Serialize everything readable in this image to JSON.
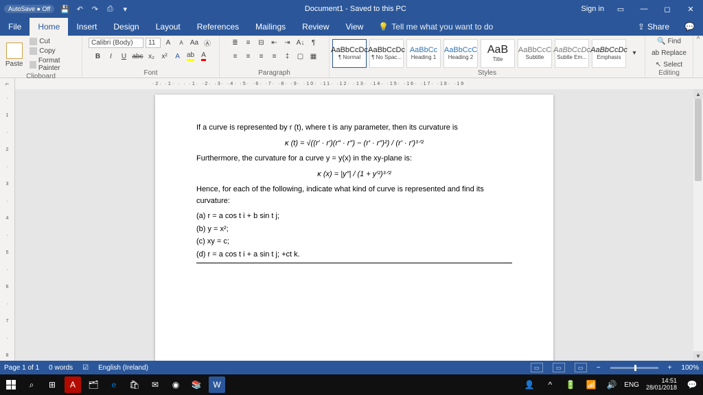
{
  "titlebar": {
    "autosave": "AutoSave ● Off",
    "title": "Document1 - Saved to this PC",
    "signin": "Sign in"
  },
  "tabs": {
    "file": "File",
    "home": "Home",
    "insert": "Insert",
    "design": "Design",
    "layout": "Layout",
    "references": "References",
    "mailings": "Mailings",
    "review": "Review",
    "view": "View",
    "tellme": "Tell me what you want to do",
    "share": "Share"
  },
  "ribbon": {
    "clipboard": {
      "label": "Clipboard",
      "paste": "Paste",
      "cut": "Cut",
      "copy": "Copy",
      "painter": "Format Painter"
    },
    "font": {
      "label": "Font",
      "name": "Calibri (Body)",
      "size": "11",
      "grow": "A",
      "shrink": "A",
      "case": "Aa",
      "bold": "B",
      "italic": "I",
      "underline": "U",
      "strike": "abc",
      "sub": "x₂",
      "sup": "x²",
      "effects": "A"
    },
    "paragraph": {
      "label": "Paragraph"
    },
    "styles": {
      "label": "Styles",
      "items": [
        {
          "sample": "AaBbCcDc",
          "name": "¶ Normal"
        },
        {
          "sample": "AaBbCcDc",
          "name": "¶ No Spac..."
        },
        {
          "sample": "AaBbCc",
          "name": "Heading 1"
        },
        {
          "sample": "AaBbCcC",
          "name": "Heading 2"
        },
        {
          "sample": "AaB",
          "name": "Title"
        },
        {
          "sample": "AaBbCcC",
          "name": "Subtitle"
        },
        {
          "sample": "AaBbCcDc",
          "name": "Subtle Em..."
        },
        {
          "sample": "AaBbCcDc",
          "name": "Emphasis"
        }
      ]
    },
    "editing": {
      "label": "Editing",
      "find": "Find",
      "replace": "Replace",
      "select": "Select"
    }
  },
  "ruler_corner": "⌐",
  "doc": {
    "p1": "If a curve is represented by r (t), where t is any parameter, then its curvature is",
    "eq1": "κ (t) = √((r′ · r′)(r″ · r″) − (r′ · r″)²) / (r′ · r′)³ᐟ²",
    "p2": "Furthermore, the curvature for a curve y = y(x) in the xy-plane is:",
    "eq2": "κ (x) = |y″| / (1 + y′²)³ᐟ²",
    "p3": "Hence, for each of the following, indicate what kind of curve is represented and find its curvature:",
    "a": "(a)  r = a cos t i + b sin t j;",
    "b": "(b)  y = x²;",
    "c": "(c)  xy = c;",
    "d": "(d)  r = a cos t i + a sin t j; +ct k."
  },
  "status": {
    "page": "Page 1 of 1",
    "words": "0 words",
    "lang": "English (Ireland)",
    "zoom": "100%"
  },
  "taskbar": {
    "lang": "ENG",
    "time": "14:51",
    "date": "28/01/2018"
  }
}
